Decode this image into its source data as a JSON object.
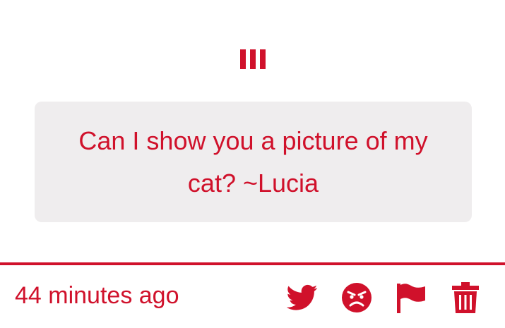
{
  "message": {
    "text": "Can I show you a picture of my cat? ~Lucia"
  },
  "footer": {
    "timestamp": "44 minutes ago"
  },
  "icons": {
    "drag_handle": "drag-handle-icon",
    "share": "twitter-icon",
    "react": "angry-face-icon",
    "report": "flag-icon",
    "delete": "trash-icon"
  },
  "colors": {
    "accent": "#d0112b",
    "card_background": "#efedee",
    "page_background": "#ffffff"
  }
}
